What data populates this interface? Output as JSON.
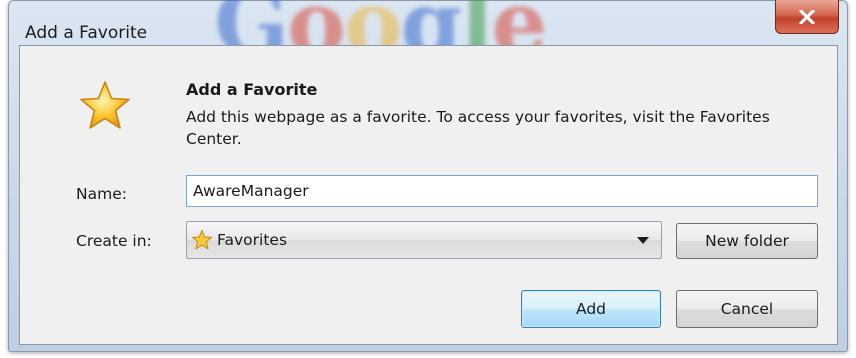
{
  "background": {
    "brand_text": "Google",
    "brand_colors": [
      "#3b6ccf",
      "#d84a3a",
      "#e9b53a",
      "#3b6ccf",
      "#3a9a4a",
      "#d84a3a"
    ]
  },
  "window": {
    "title": "Add a Favorite",
    "close_icon": "close-icon"
  },
  "header": {
    "icon": "star-icon",
    "title": "Add a Favorite",
    "description": "Add this webpage as a favorite. To access your favorites, visit the Favorites Center."
  },
  "form": {
    "name_label": "Name:",
    "name_value": "AwareManager",
    "create_in_label": "Create in:",
    "create_in_value": "Favorites",
    "create_in_icon": "folder-star-icon",
    "new_folder_label": "New folder"
  },
  "buttons": {
    "add_label": "Add",
    "cancel_label": "Cancel"
  },
  "colors": {
    "dialog_body": "#f0f0f0",
    "title_bar": "#c8d7e8",
    "close_button": "#c1412a",
    "default_button": "#bee6fd",
    "star": "#f4b21c"
  }
}
